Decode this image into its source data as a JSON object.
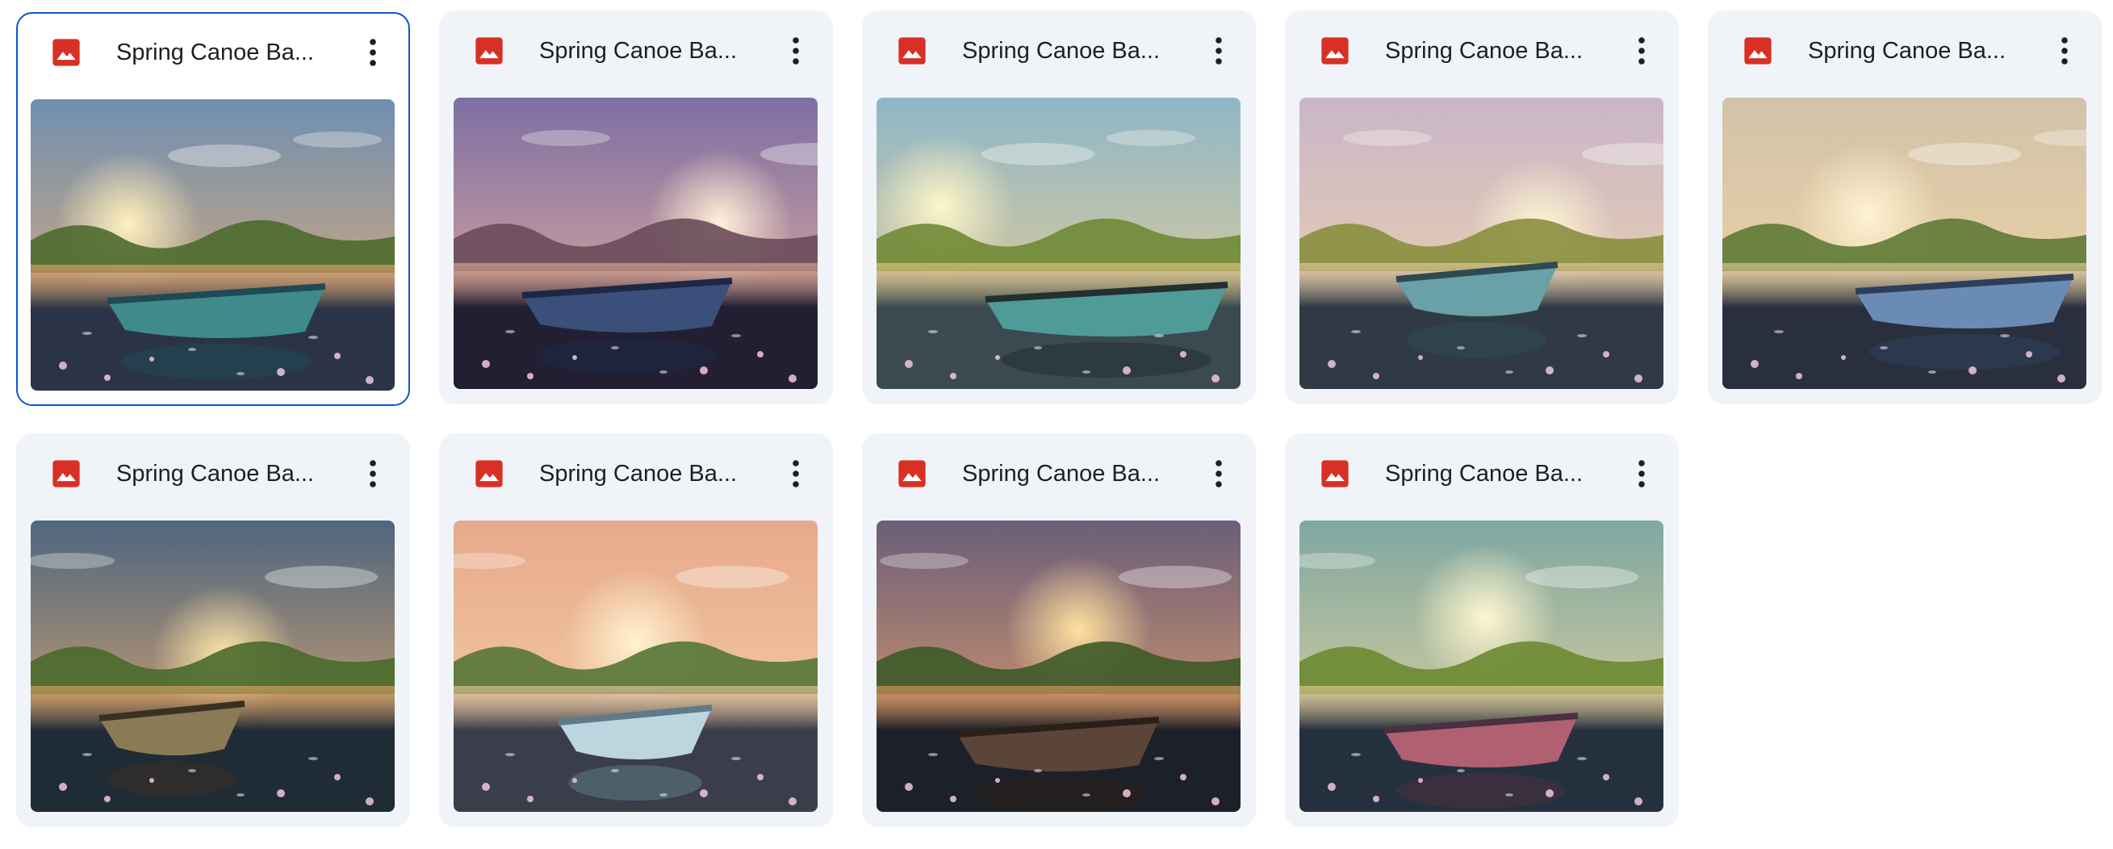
{
  "files": [
    {
      "name": "Spring Canoe Ba...",
      "theme": {
        "skyTop": "#6f8fb0",
        "skyBottom": "#f3b06e",
        "water": "#2b3346",
        "veg": "#4d6a2f",
        "boat": "#3f8a8a",
        "boatDark": "#1f4a55",
        "sun": "#fff2c0"
      }
    },
    {
      "name": "Spring Canoe Ba...",
      "theme": {
        "skyTop": "#7e6fa3",
        "skyBottom": "#f0b59b",
        "water": "#231f33",
        "veg": "#6a4b5a",
        "boat": "#3a4f7a",
        "boatDark": "#1e2845",
        "sun": "#fff0d8"
      }
    },
    {
      "name": "Spring Canoe Ba...",
      "theme": {
        "skyTop": "#8fb6c8",
        "skyBottom": "#f4d28c",
        "water": "#3a4a50",
        "veg": "#6f8a35",
        "boat": "#4f9b98",
        "boatDark": "#23302f",
        "sun": "#fff6c8"
      }
    },
    {
      "name": "Spring Canoe Ba...",
      "theme": {
        "skyTop": "#c9b6c8",
        "skyBottom": "#f2d6a8",
        "water": "#2f3a45",
        "veg": "#8a8e3e",
        "boat": "#6aa0a8",
        "boatDark": "#2e4a52",
        "sun": "#fff6d6"
      }
    },
    {
      "name": "Spring Canoe Ba...",
      "theme": {
        "skyTop": "#d2c2a8",
        "skyBottom": "#f4d8a6",
        "water": "#2a2f3d",
        "veg": "#5f7a35",
        "boat": "#6a8cb4",
        "boatDark": "#2e3f5c",
        "sun": "#fff3d2"
      }
    },
    {
      "name": "Spring Canoe Ba...",
      "theme": {
        "skyTop": "#4f6680",
        "skyBottom": "#f2b06a",
        "water": "#1f2b35",
        "veg": "#4a6a2c",
        "boat": "#8a7a55",
        "boatDark": "#3a3022",
        "sun": "#ffe8a8"
      }
    },
    {
      "name": "Spring Canoe Ba...",
      "theme": {
        "skyTop": "#e7a98c",
        "skyBottom": "#f6d4a8",
        "water": "#3a3e4a",
        "veg": "#557536",
        "boat": "#bcd6e0",
        "boatDark": "#5f7a88",
        "sun": "#fff2d0"
      }
    },
    {
      "name": "Spring Canoe Ba...",
      "theme": {
        "skyTop": "#6b5e7a",
        "skyBottom": "#f2a768",
        "water": "#1c2029",
        "veg": "#3d5a28",
        "boat": "#5a4538",
        "boatDark": "#2a2018",
        "sun": "#ffe1a0"
      }
    },
    {
      "name": "Spring Canoe Ba...",
      "theme": {
        "skyTop": "#7fa8a2",
        "skyBottom": "#f2d79a",
        "water": "#25303e",
        "veg": "#6c8a30",
        "boat": "#b06070",
        "boatDark": "#4a3040",
        "sun": "#fff7d0"
      }
    }
  ]
}
